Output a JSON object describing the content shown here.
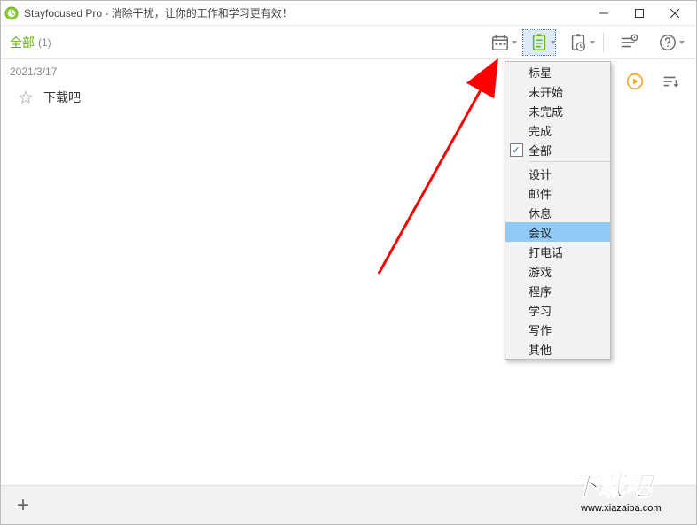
{
  "title": "Stayfocused Pro - 消除干扰，让你的工作和学习更有效！",
  "filter": {
    "label": "全部",
    "count": "(1)"
  },
  "date_header": "2021/3/17",
  "task": {
    "title": "下载吧"
  },
  "menu": {
    "group1": [
      "标星",
      "未开始",
      "未完成",
      "完成",
      "全部"
    ],
    "checked_index": 4,
    "group2": [
      "设计",
      "邮件",
      "休息",
      "会议",
      "打电话",
      "游戏",
      "程序",
      "学习",
      "写作",
      "其他"
    ],
    "hovered_index": 3
  },
  "watermark": {
    "text": "下载吧",
    "url": "www.xiazaiba.com"
  }
}
